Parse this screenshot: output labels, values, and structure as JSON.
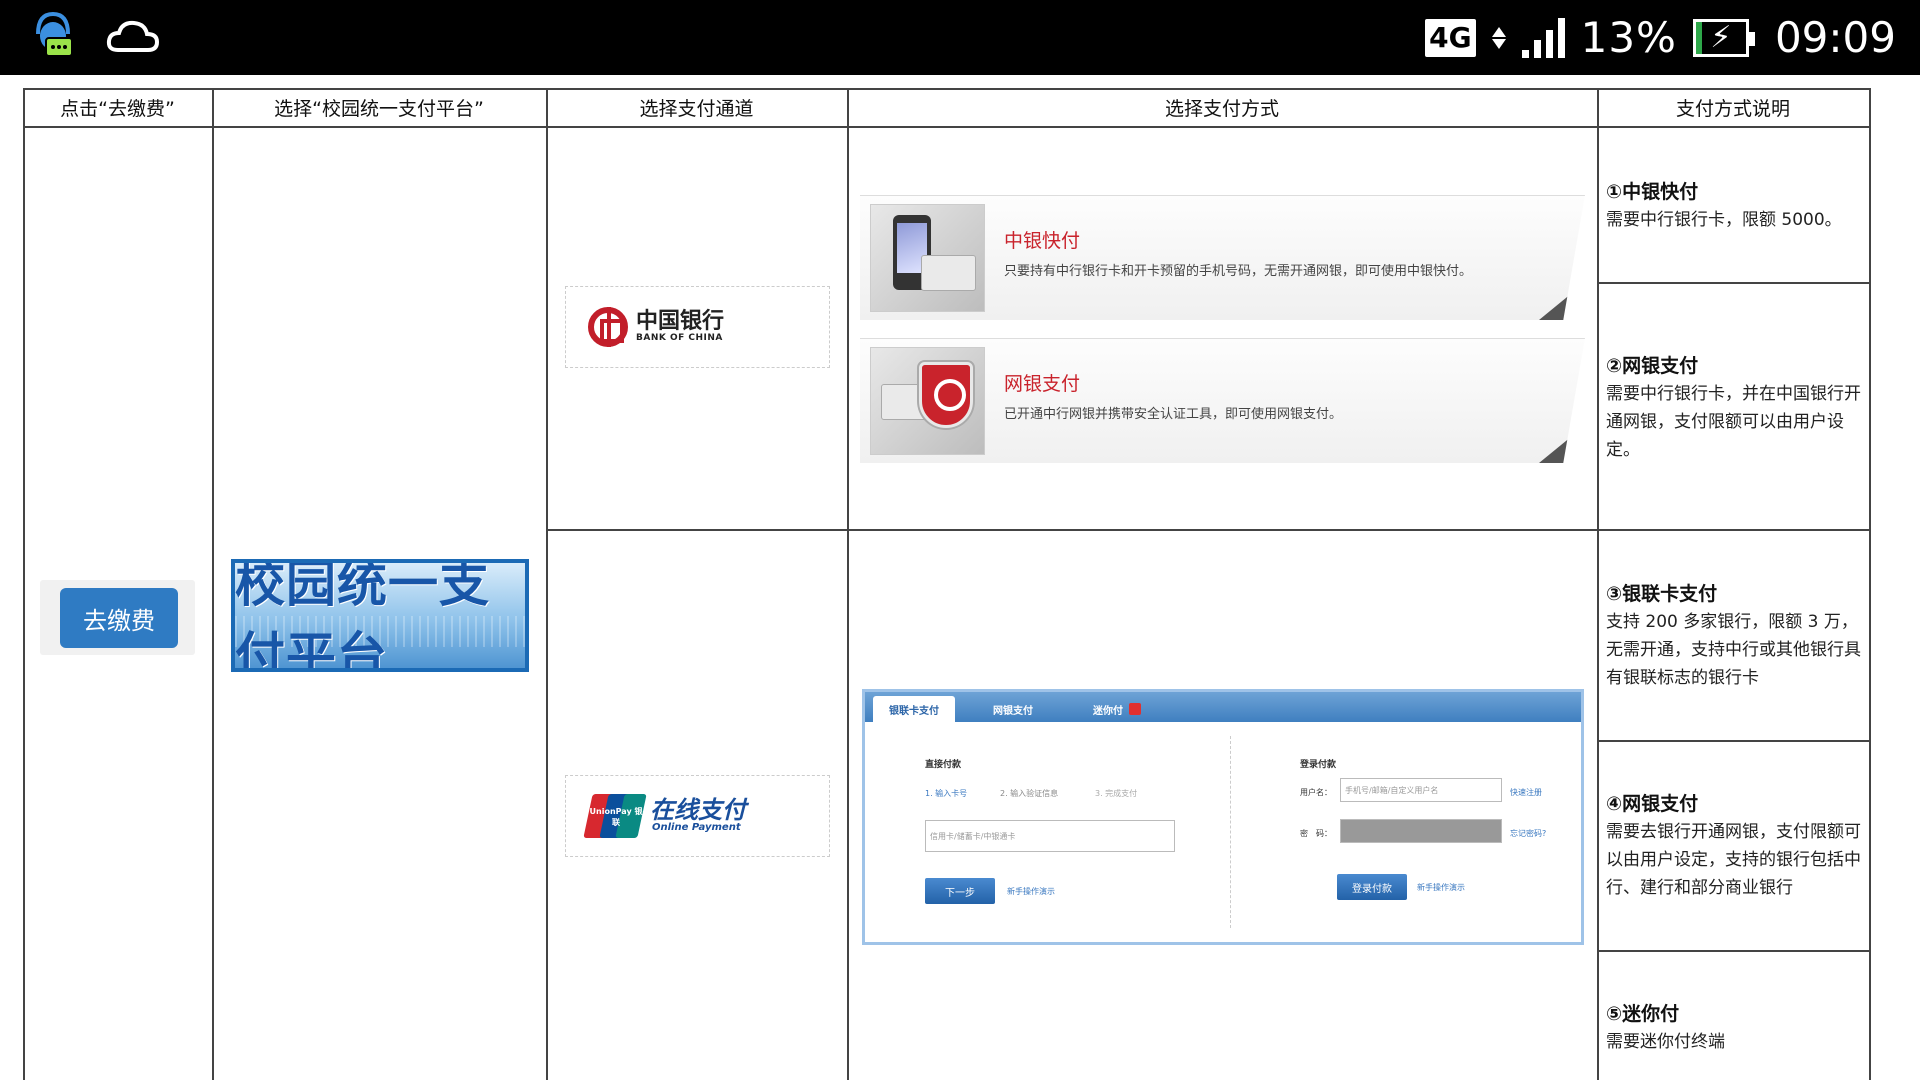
{
  "status_bar": {
    "network": "4G",
    "battery_percent": "13%",
    "battery_level": 0.13,
    "time": "09:09",
    "colors": {
      "background": "#000000",
      "battery_charge": "#2ea84a"
    }
  },
  "headers": [
    "点击“去缴费”",
    "选择“校园统一支付平台”",
    "选择支付通道",
    "选择支付方式",
    "支付方式说明"
  ],
  "go_pay_button": "去缴费",
  "campus_banner": "校园统一支付平台",
  "channels": {
    "boc": {
      "name_cn": "中国银行",
      "name_en": "BANK OF CHINA"
    },
    "unionpay": {
      "logo_text": "UnionPay 银联",
      "name_cn": "在线支付",
      "name_en": "Online Payment"
    }
  },
  "methods": {
    "boc_quick": {
      "title": "中银快付",
      "desc": "只要持有中行银行卡和开卡预留的手机号码，无需开通网银，即可使用中银快付。"
    },
    "boc_netbank": {
      "title": "网银支付",
      "desc": "已开通中行网银并携带安全认证工具，即可使用网银支付。"
    }
  },
  "unionpay_panel": {
    "tabs": [
      "银联卡支付",
      "网银支付",
      "迷你付"
    ],
    "direct": {
      "title": "直接付款",
      "steps": [
        "1. 输入卡号",
        "2. 输入验证信息",
        "3. 完成支付"
      ],
      "card_placeholder": "信用卡/储蓄卡/中银通卡",
      "next_button": "下一步",
      "demo_link": "新手操作演示"
    },
    "login": {
      "title": "登录付款",
      "username_label": "用户名：",
      "username_placeholder": "手机号/邮箱/自定义用户名",
      "register_link": "快速注册",
      "password_label": "密　码：",
      "forgot_link": "忘记密码?",
      "login_button": "登录付款",
      "demo_link": "新手操作演示"
    }
  },
  "descriptions": [
    {
      "title": "①中银快付",
      "body": "需要中行银行卡，限额 5000。"
    },
    {
      "title": "②网银支付",
      "body": "需要中行银行卡，并在中国银行开通网银，支付限额可以由用户设定。"
    },
    {
      "title": "③银联卡支付",
      "body": "支持 200 多家银行，限额 3 万，无需开通，支持中行或其他银行具有银联标志的银行卡"
    },
    {
      "title": "④网银支付",
      "body": "需要去银行开通网银，支付限额可以由用户设定，支持的银行包括中行、建行和部分商业银行"
    },
    {
      "title": "⑤迷你付",
      "body": "需要迷你付终端"
    }
  ]
}
